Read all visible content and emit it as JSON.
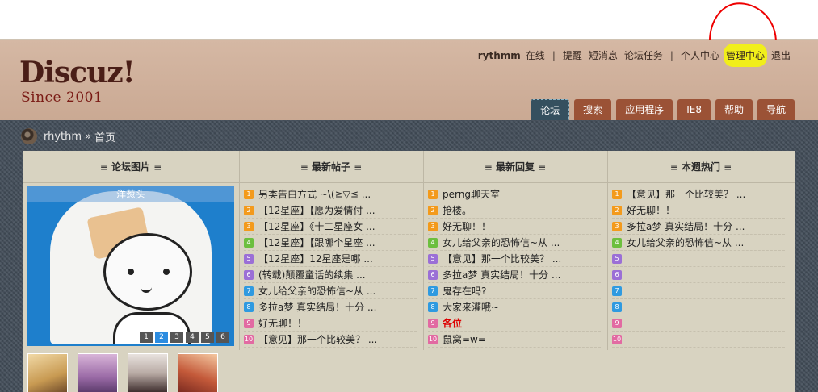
{
  "logo": {
    "brand": "Discuz!",
    "since": "Since 2001"
  },
  "user_bar": {
    "username": "rythmm",
    "status": "在线",
    "links": [
      "提醒",
      "短消息",
      "论坛任务",
      "个人中心",
      "管理中心",
      "退出"
    ]
  },
  "nav_tabs": [
    "论坛",
    "搜索",
    "应用程序",
    "IE8",
    "帮助",
    "导航"
  ],
  "breadcrumb": {
    "site": "rhythm",
    "separator": "»",
    "current": "首页"
  },
  "columns": {
    "images": "≡ 论坛图片 ≡",
    "new_posts": "≡ 最新帖子 ≡",
    "new_replies": "≡ 最新回复 ≡",
    "hot": "≡ 本週热门 ≡"
  },
  "carousel": {
    "caption": "洋葱头",
    "pages": [
      "1",
      "2",
      "3",
      "4",
      "5",
      "6"
    ],
    "active_page": "2"
  },
  "new_posts": [
    "另类告白方式 ~\\(≧▽≦ ...",
    "【12星座】【愿为爱情付 ...",
    "【12星座】《十二星座女 ...",
    "【12星座】【跟哪个星座 ...",
    "【12星座】12星座是哪 ...",
    "(转载)颠覆童话的续集 ...",
    "女儿给父亲的恐怖信~从 ...",
    "多拉a梦 真实结局！十分 ...",
    "好无聊！！",
    "【意见】那一个比较美？ ..."
  ],
  "new_replies": [
    "perng聊天室",
    "抢楼。",
    "好无聊！！",
    "女儿给父亲的恐怖信~从 ...",
    "【意见】那一个比较美？ ...",
    "多拉a梦 真实结局！十分 ...",
    "鬼存在吗?",
    "大家来灌哦~",
    "各位",
    "鼠窝=w="
  ],
  "hot": [
    "【意见】那一个比较美？ ...",
    "好无聊！！",
    "多拉a梦 真实结局！十分 ...",
    "女儿给父亲的恐怖信~从 ...",
    "",
    "",
    "",
    "",
    "",
    ""
  ],
  "colors": {
    "header": "#caa993",
    "tab": "#9b5236",
    "tab_active": "#35505f",
    "panel": "#d8d3c1",
    "highlight": "#f1ee1a",
    "annotation": "#e00000"
  }
}
